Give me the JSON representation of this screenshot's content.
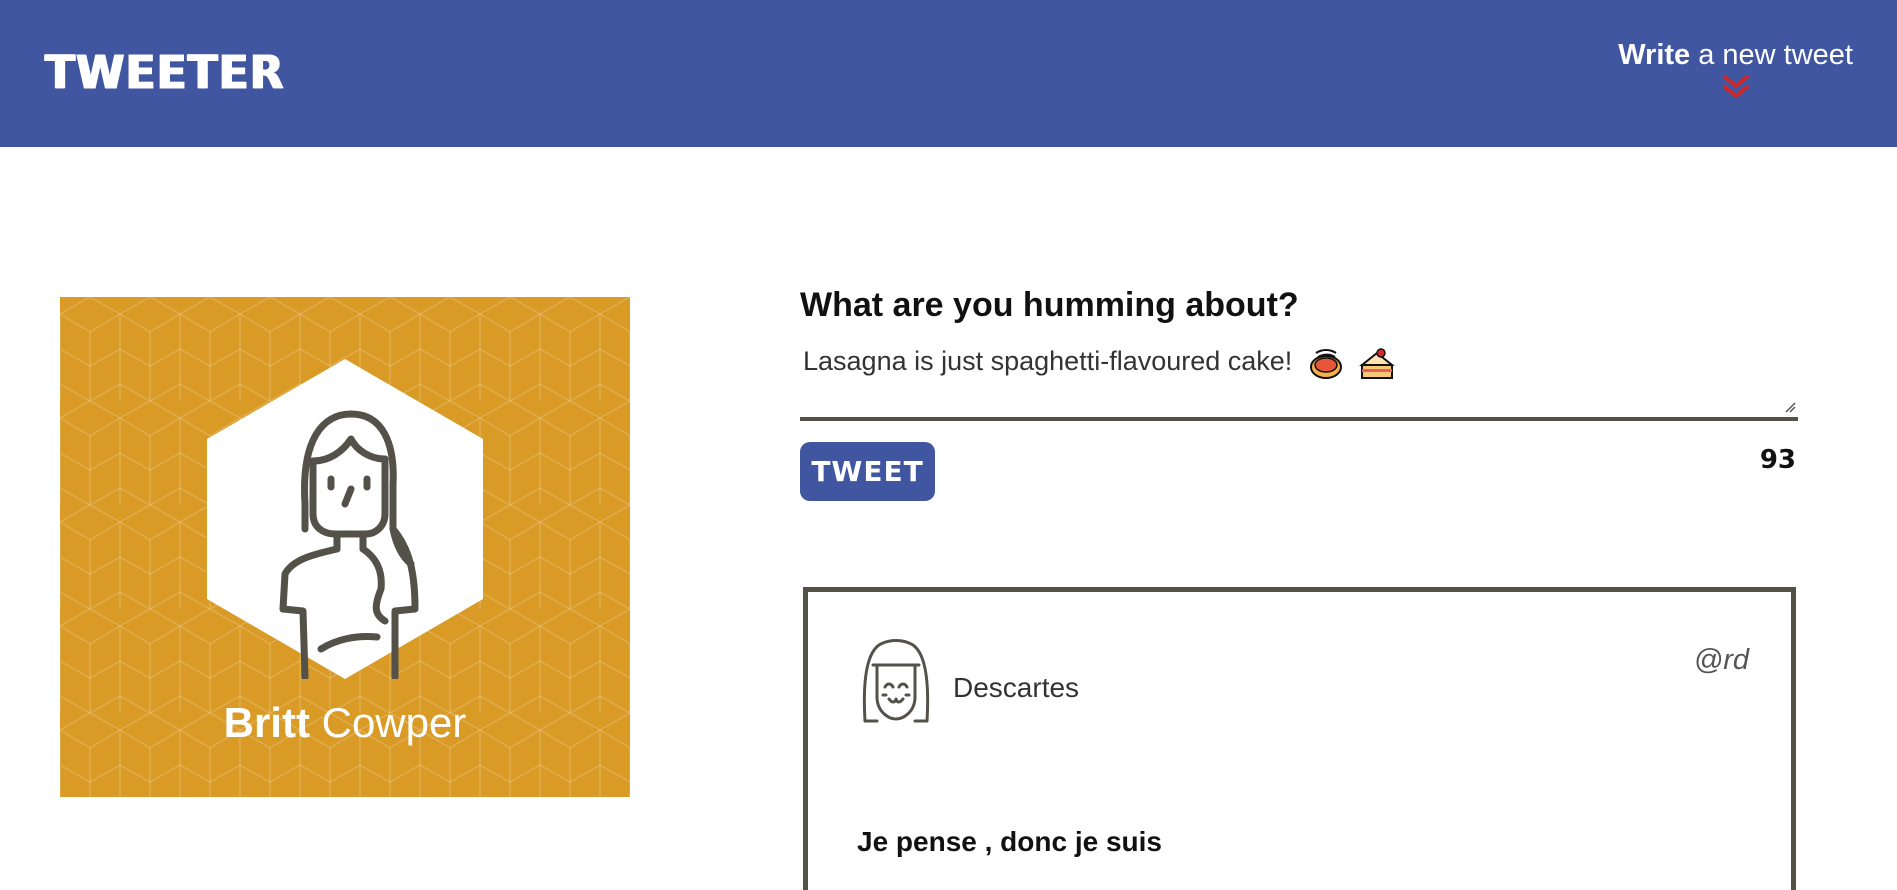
{
  "nav": {
    "brand": "TWEETER",
    "compose_bold": "Write",
    "compose_rest": " a new tweet",
    "chevron_icon": "double-chevron-down-icon",
    "chevron_color": "#cc2a2a",
    "background": "#4056a1"
  },
  "profile": {
    "first_name": "Britt",
    "last_name": " Cowper",
    "avatar_icon": "woman-avatar-icon",
    "background": "#d99a26"
  },
  "composer": {
    "label": "What are you humming about?",
    "value": "Lasagna is just spaghetti-flavoured cake!",
    "emojis": [
      "spaghetti-emoji",
      "cake-emoji"
    ],
    "button_label": "TWEET",
    "char_count": "93"
  },
  "tweet": {
    "author": "Descartes",
    "handle": "@rd",
    "content": "Je pense , donc je suis",
    "avatar_icon": "girl-avatar-icon"
  }
}
